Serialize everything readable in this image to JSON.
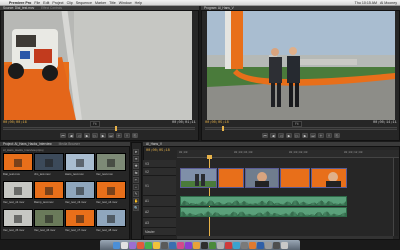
{
  "menubar": {
    "apple": "",
    "menus": [
      "Premiere Pro",
      "File",
      "Edit",
      "Project",
      "Clip",
      "Sequence",
      "Marker",
      "Title",
      "Window",
      "Help"
    ],
    "right": [
      "Thu 10:15 AM",
      "Al Mooney"
    ]
  },
  "source_monitor": {
    "tab": "Source: Dial_test.mov",
    "sub_tab": "Effect Controls",
    "timecode": "00;00;00;16",
    "fit": "Fit",
    "duration": "00;00;01;11"
  },
  "program_monitor": {
    "tab": "Program: Al_Hans_V",
    "timecode": "00;00;05;18",
    "fit": "Fit",
    "duration": "00;00;14;11"
  },
  "project_panel": {
    "tab": "Project: Al_Hans_Hacks_Interview",
    "sub_tab": "Media Browser",
    "path": "Al_Hans_Hacks_Interview.prproj",
    "items": [
      {
        "name": "Diai_test.mov"
      },
      {
        "name": "Jim_test.mov"
      },
      {
        "name": "Hans_test.mov"
      },
      {
        "name": "Vec_test.mov"
      },
      {
        "name": "Vec_test_v2.mov"
      },
      {
        "name": "Ramp_test.mov"
      },
      {
        "name": "Vec_test_v3.mov"
      },
      {
        "name": "Vec_test_v4.mov"
      },
      {
        "name": "Vec_test_v5.mov"
      },
      {
        "name": "Vec_test_v6.mov"
      },
      {
        "name": "Vec_test_v7.mov"
      },
      {
        "name": "Vec_test_v8.mov"
      }
    ]
  },
  "tools": [
    "➤",
    "⇹",
    "✚",
    "⇆",
    "✂",
    "⇔",
    "✎",
    "✋",
    "🔍"
  ],
  "timeline": {
    "tab": "Al_Hans_V",
    "timecode": "00;00;05;18",
    "ruler_labels": [
      "00;00",
      "00;00;04;00",
      "00;00;08;00",
      "00;00;12;00"
    ],
    "tracks": [
      {
        "name": "V3"
      },
      {
        "name": "V2"
      },
      {
        "name": "V1"
      },
      {
        "name": "A1"
      },
      {
        "name": "A2"
      },
      {
        "name": "A3"
      },
      {
        "name": "Master"
      }
    ]
  },
  "colors": {
    "timecode": "#e8b34a",
    "video_clip": "#8c8fd0",
    "audio_clip": "#5aa07a",
    "ramp_orange": "#e86f1a"
  }
}
